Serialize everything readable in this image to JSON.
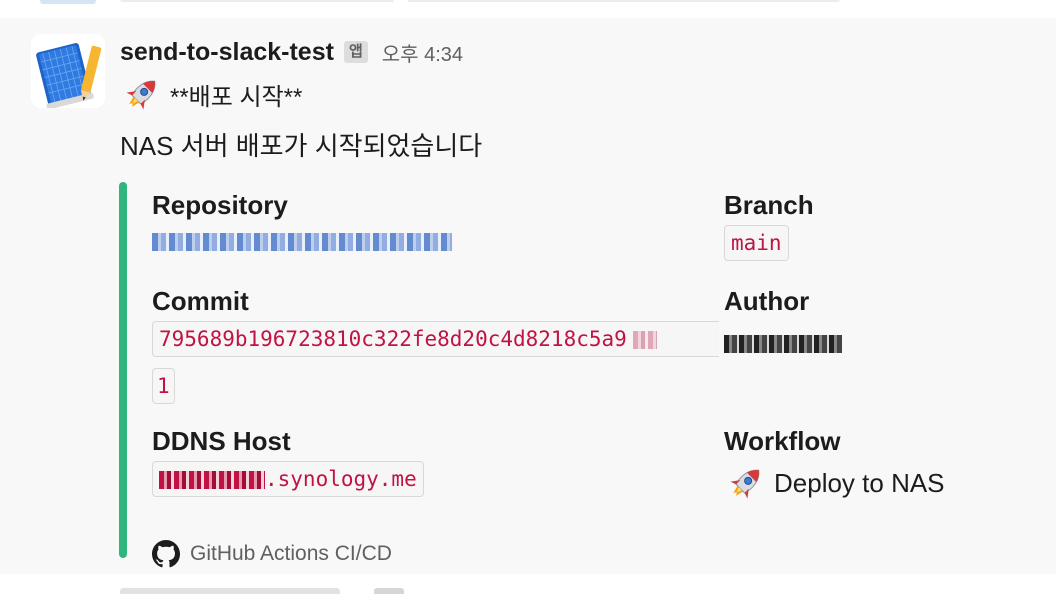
{
  "message": {
    "sender": "send-to-slack-test",
    "app_badge": "앱",
    "time": "오후 4:34",
    "line1_text": "**배포 시작**",
    "line2_text": "NAS 서버 배포가 시작되었습니다"
  },
  "attachment": {
    "accent_color": "#2eb67d",
    "fields": {
      "repository": {
        "title": "Repository",
        "value": ""
      },
      "branch": {
        "title": "Branch",
        "value": "main"
      },
      "commit": {
        "title": "Commit",
        "value": "795689b196723810c322fe8d20c4d8218c5a9",
        "value_wrap": "1"
      },
      "author": {
        "title": "Author",
        "value": ""
      },
      "ddns_host": {
        "title": "DDNS Host",
        "value": ".synology.me"
      },
      "workflow": {
        "title": "Workflow",
        "value": "Deploy to NAS",
        "icon": "rocket-icon"
      }
    },
    "footer": {
      "icon": "github-icon",
      "text": "GitHub Actions CI/CD"
    }
  }
}
